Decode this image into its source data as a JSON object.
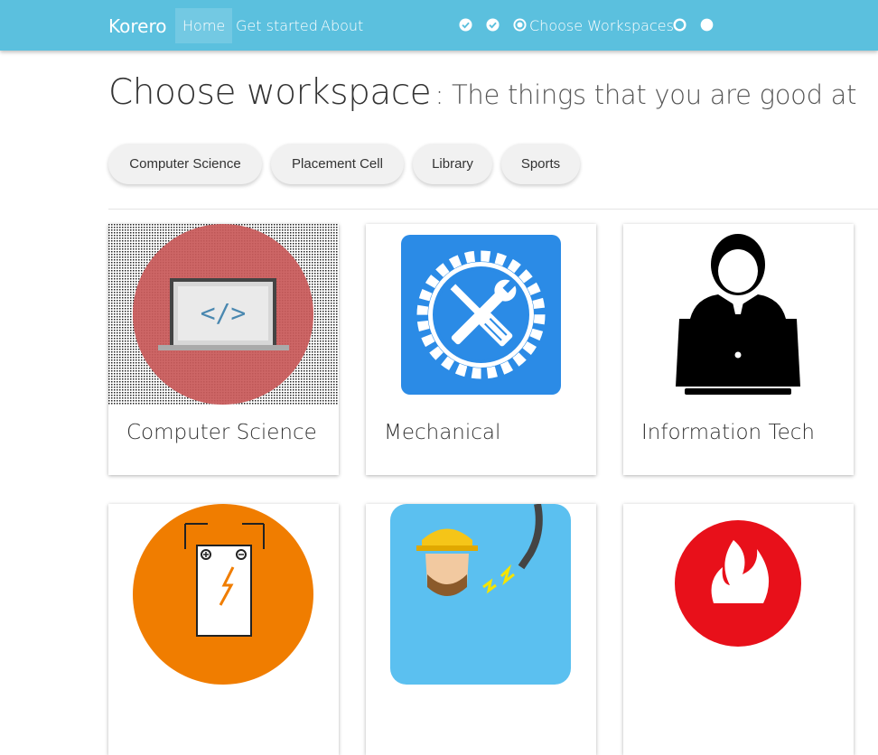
{
  "navbar": {
    "brand": "Korero",
    "links": [
      "Home",
      "Get started",
      "About"
    ],
    "steps": {
      "current_label": "Choose Workspaces",
      "icons": [
        "check-circle-icon",
        "check-circle-icon",
        "radio-dot-icon",
        "ring-icon",
        "filled-dot-icon"
      ]
    },
    "color": "#5bc0de"
  },
  "heading": {
    "title": "Choose workspace",
    "subtitle": ": The things that you are good at"
  },
  "chips": [
    "Computer Science",
    "Placement Cell",
    "Library",
    "Sports"
  ],
  "cards": [
    {
      "title": "Computer Science",
      "icon": "laptop-code-icon"
    },
    {
      "title": "Mechanical",
      "icon": "gear-tools-icon"
    },
    {
      "title": "Information Tech",
      "icon": "person-laptop-icon"
    },
    {
      "title": "",
      "icon": "battery-icon"
    },
    {
      "title": "",
      "icon": "electrician-icon"
    },
    {
      "title": "",
      "icon": "flame-icon"
    }
  ]
}
